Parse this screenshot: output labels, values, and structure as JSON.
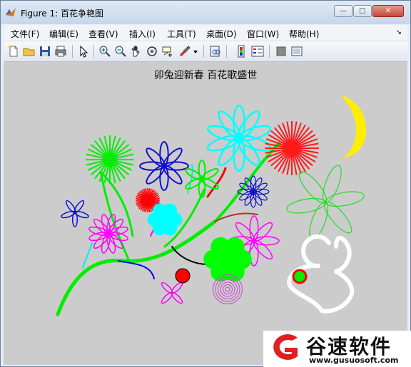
{
  "window": {
    "title": "Figure 1: 百花争艳图",
    "minimize": "—",
    "maximize": "□",
    "close": "✕"
  },
  "menu": {
    "items": [
      {
        "label": "文件(F)"
      },
      {
        "label": "编辑(E)"
      },
      {
        "label": "查看(V)"
      },
      {
        "label": "插入(I)"
      },
      {
        "label": "工具(T)"
      },
      {
        "label": "桌面(D)"
      },
      {
        "label": "窗口(W)"
      },
      {
        "label": "帮助(H)"
      }
    ],
    "dock_arrow": "↘"
  },
  "toolbar": {
    "icons": [
      "new-file-icon",
      "open-folder-icon",
      "save-icon",
      "print-icon",
      "pointer-icon",
      "zoom-in-icon",
      "zoom-out-icon",
      "pan-icon",
      "rotate-3d-icon",
      "data-cursor-icon",
      "brush-icon",
      "brush-dropdown-icon",
      "link-plot-icon",
      "colorbar-icon",
      "legend-icon",
      "hide-plot-tools-icon",
      "show-plot-tools-icon"
    ]
  },
  "figure": {
    "title": "卯兔迎新春 百花歌盛世",
    "colors": {
      "background": "#cccccc",
      "stem": "#00ee00",
      "moon": "#ffee00",
      "rabbit": "#ffffff",
      "rabbit_eye": "#ff0000"
    }
  },
  "watermark": {
    "name": "谷速软件",
    "url": "www.gusuosoft.com"
  }
}
